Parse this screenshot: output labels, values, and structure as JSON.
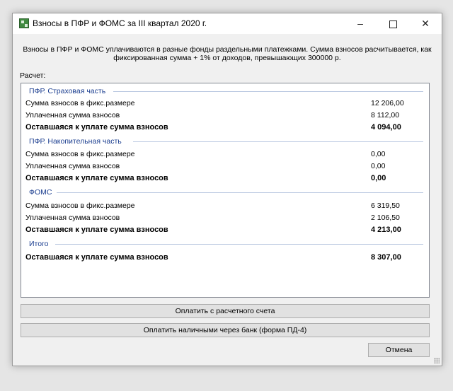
{
  "window": {
    "title": "Взносы в ПФР и ФОМС за III квартал 2020 г.",
    "controls": {
      "minimize": "–",
      "close": "✕"
    }
  },
  "intro": {
    "line1": "Взносы в ПФР и ФОМС уплачиваются в разные фонды раздельными платежками. Сумма взносов расчитывается, как",
    "line2": "фиксированная сумма + 1% от доходов, превышающих 300000 р."
  },
  "calc_label": "Расчет:",
  "sections": [
    {
      "title": "ПФР. Страховая часть",
      "rows": [
        {
          "label": "Сумма взносов в фикс.размере",
          "value": "12 206,00",
          "bold": false
        },
        {
          "label": "Уплаченная сумма взносов",
          "value": "8 112,00",
          "bold": false
        },
        {
          "label": "Оставшаяся к уплате сумма взносов",
          "value": "4 094,00",
          "bold": true
        }
      ]
    },
    {
      "title": "ПФР. Накопительная часть",
      "rows": [
        {
          "label": "Сумма взносов в фикс.размере",
          "value": "0,00",
          "bold": false
        },
        {
          "label": "Уплаченная сумма взносов",
          "value": "0,00",
          "bold": false
        },
        {
          "label": "Оставшаяся к уплате сумма взносов",
          "value": "0,00",
          "bold": true
        }
      ]
    },
    {
      "title": "ФОМС",
      "rows": [
        {
          "label": "Сумма взносов в фикс.размере",
          "value": "6 319,50",
          "bold": false
        },
        {
          "label": "Уплаченная сумма взносов",
          "value": "2 106,50",
          "bold": false
        },
        {
          "label": "Оставшаяся к уплате сумма взносов",
          "value": "4 213,00",
          "bold": true
        }
      ]
    },
    {
      "title": "Итого",
      "rows": [
        {
          "label": "Оставшаяся к уплате сумма взносов",
          "value": "8 307,00",
          "bold": true
        }
      ]
    }
  ],
  "buttons": {
    "pay_account": "Оплатить с расчетного счета",
    "pay_cash": "Оплатить наличными через банк (форма ПД-4)",
    "cancel": "Отмена"
  },
  "colors": {
    "section_title": "#1a3d8f",
    "section_line": "#b9c7e0",
    "window_bg": "#f0f0f0"
  }
}
